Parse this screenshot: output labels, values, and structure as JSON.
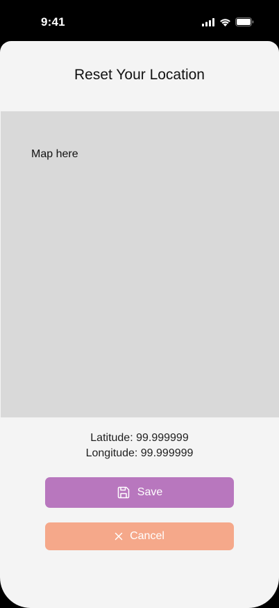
{
  "status_bar": {
    "time": "9:41",
    "icons": [
      "cellular-signal-icon",
      "wifi-icon",
      "battery-icon"
    ]
  },
  "sheet": {
    "title": "Reset Your Location"
  },
  "map": {
    "placeholder": "Map here",
    "background_color": "#d9d9d9"
  },
  "location": {
    "latitude_text": "Latitude: 99.999999",
    "longitude_text": "Longitude: 99.999999"
  },
  "actions": {
    "save": {
      "label": "Save",
      "icon": "save-icon",
      "color": "#b877be"
    },
    "cancel": {
      "label": "Cancel",
      "icon": "close-icon",
      "color": "#f5a88a"
    }
  }
}
